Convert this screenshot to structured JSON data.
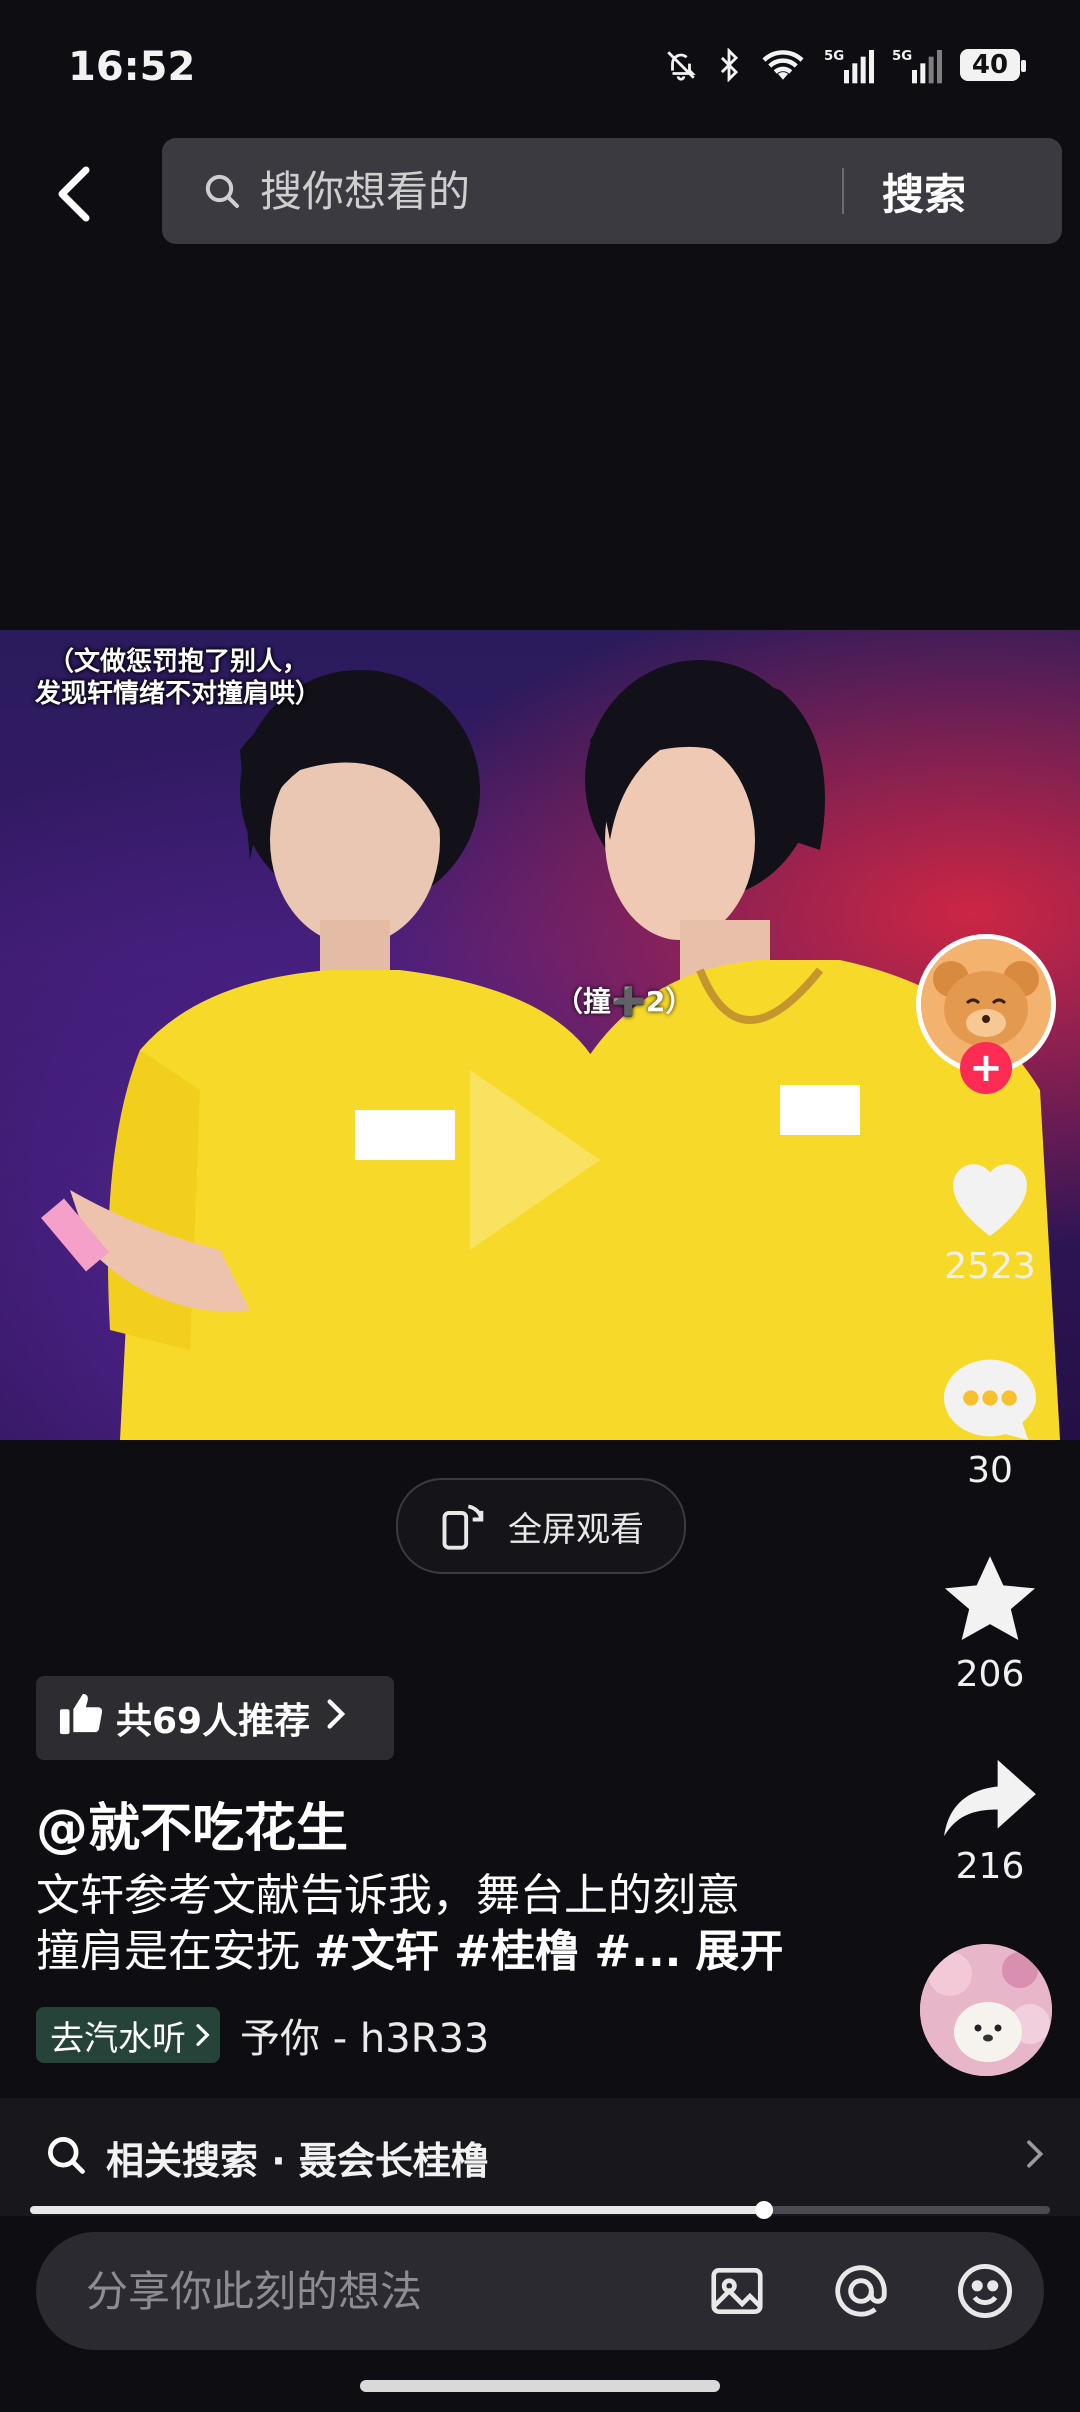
{
  "status_bar": {
    "time": "16:52",
    "battery": "40",
    "icons": [
      "bell-off-icon",
      "bluetooth-icon",
      "wifi-icon",
      "signal-5g-icon",
      "signal-5g-icon",
      "battery-icon"
    ]
  },
  "search": {
    "placeholder": "搜你想看的",
    "submit_label": "搜索"
  },
  "video": {
    "caption_line1": "（文做惩罚抱了别人，",
    "caption_line2": "发现轩情绪不对撞肩哄）",
    "overlay_text": "（撞➕2）"
  },
  "actions": {
    "likes": "2523",
    "comments": "30",
    "favorites": "206",
    "shares": "216"
  },
  "fullscreen_label": "全屏观看",
  "recommend_label": "共69人推荐",
  "post": {
    "author": "@就不吃花生",
    "description_line1": "文轩参考文献告诉我，舞台上的刻意",
    "description_line2_plain": "撞肩是在安抚 ",
    "description_tags": "#文轩 #桂橹 #...",
    "expand_label": "展开"
  },
  "music": {
    "chip_label": "去汽水听",
    "title": "予你 - h3R33"
  },
  "related_search": {
    "label": "相关搜索 · 聂会长桂橹"
  },
  "progress": {
    "fraction": 0.72
  },
  "comment": {
    "placeholder": "分享你此刻的想法"
  },
  "colors": {
    "accent": "#fe2c55",
    "background": "#0d0d12"
  }
}
